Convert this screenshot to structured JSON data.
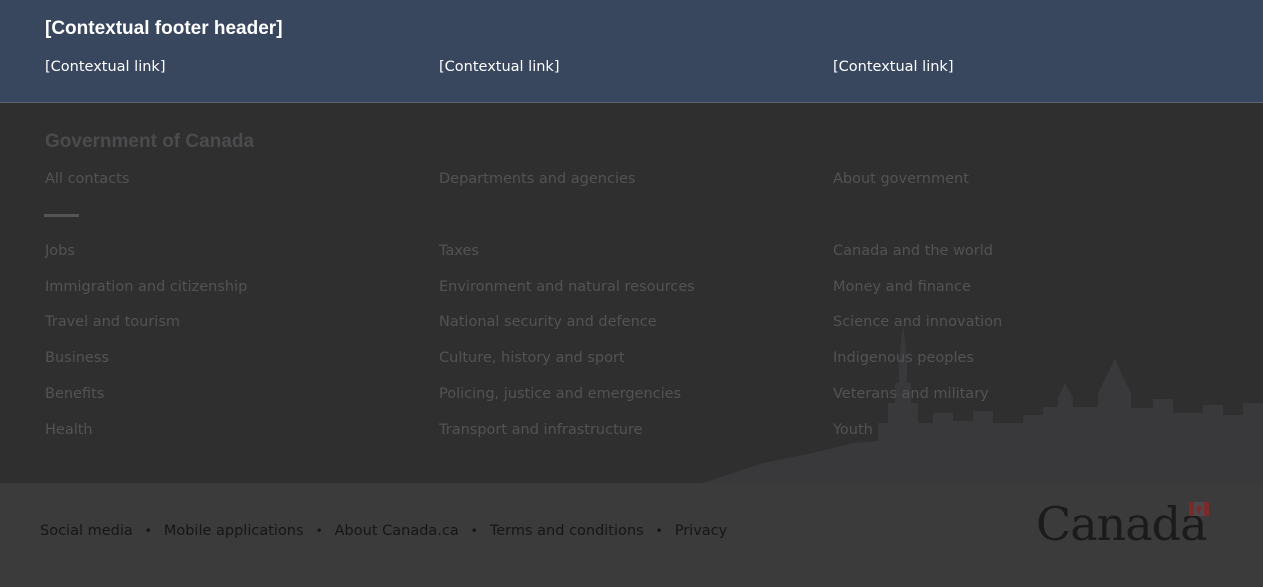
{
  "contextual_footer": {
    "header": "[Contextual footer header]",
    "links": [
      "[Contextual link]",
      "[Contextual link]",
      "[Contextual link]"
    ]
  },
  "main_footer": {
    "title": "Government of Canada",
    "top_links": [
      "All contacts",
      "Departments and agencies",
      "About government"
    ],
    "columns": [
      [
        "Jobs",
        "Immigration and citizenship",
        "Travel and tourism",
        "Business",
        "Benefits",
        "Health"
      ],
      [
        "Taxes",
        "Environment and natural resources",
        "National security and defence",
        "Culture, history and sport",
        "Policing, justice and emergencies",
        "Transport and infrastructure"
      ],
      [
        "Canada and the world",
        "Money and finance",
        "Science and innovation",
        "Indigenous peoples",
        "Veterans and military",
        "Youth"
      ]
    ]
  },
  "bottom_bar": {
    "links": [
      "Social media",
      "Mobile applications",
      "About Canada.ca",
      "Terms and conditions",
      "Privacy"
    ],
    "separator": "•",
    "wordmark": "Canada"
  },
  "colors": {
    "contextual_bg": "#38465e",
    "main_bg": "#2f2f30",
    "bottom_bg": "#3b3b3c",
    "flag_red": "#7a2a2a"
  },
  "icons": {
    "flag": "canada-flag-icon",
    "skyline": "parliament-skyline-icon"
  }
}
